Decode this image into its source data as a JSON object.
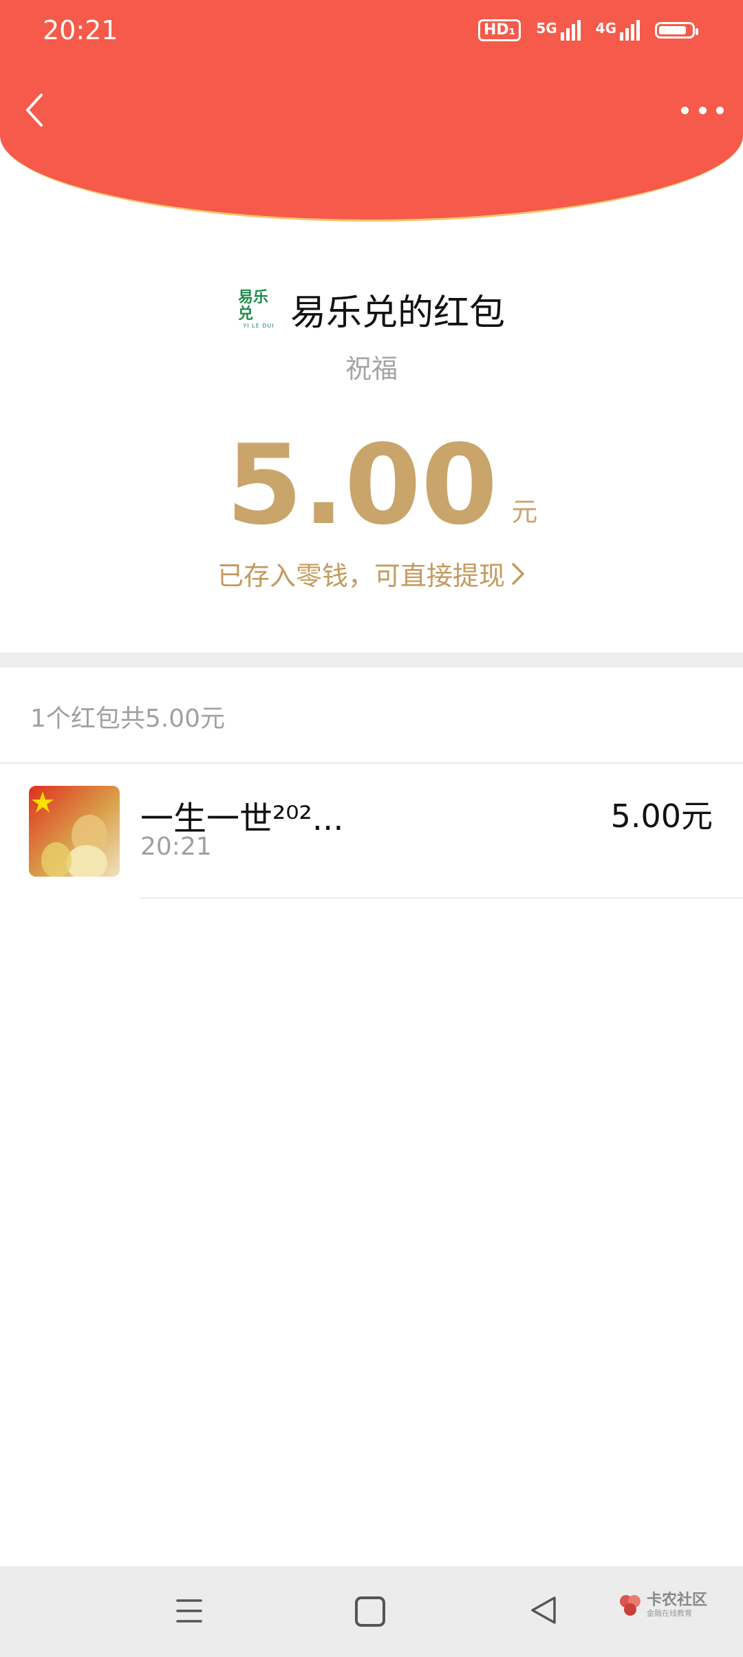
{
  "status_bar": {
    "time": "20:21",
    "hd_label": "HD₁",
    "net1_label": "5G",
    "net2_label": "4G",
    "battery_level": 0.85
  },
  "header": {
    "back_icon": "chevron-left-icon",
    "more_icon": "more-dots-icon",
    "background_color": "#f55a4a"
  },
  "sender": {
    "logo_text": "易乐兑",
    "logo_subtext": "YI LE DUI",
    "name": "易乐兑的红包",
    "greeting": "祝福"
  },
  "amount": {
    "value": "5.00",
    "unit": "元",
    "note": "已存入零钱，可直接提现",
    "accent_color": "#c9a46b"
  },
  "summary": "1个红包共5.00元",
  "records": [
    {
      "name": "一生一世²⁰²...",
      "time": "20:21",
      "amount": "5.00元"
    }
  ],
  "watermark": {
    "title": "卡农社区",
    "subtitle": "金融在线教育"
  }
}
